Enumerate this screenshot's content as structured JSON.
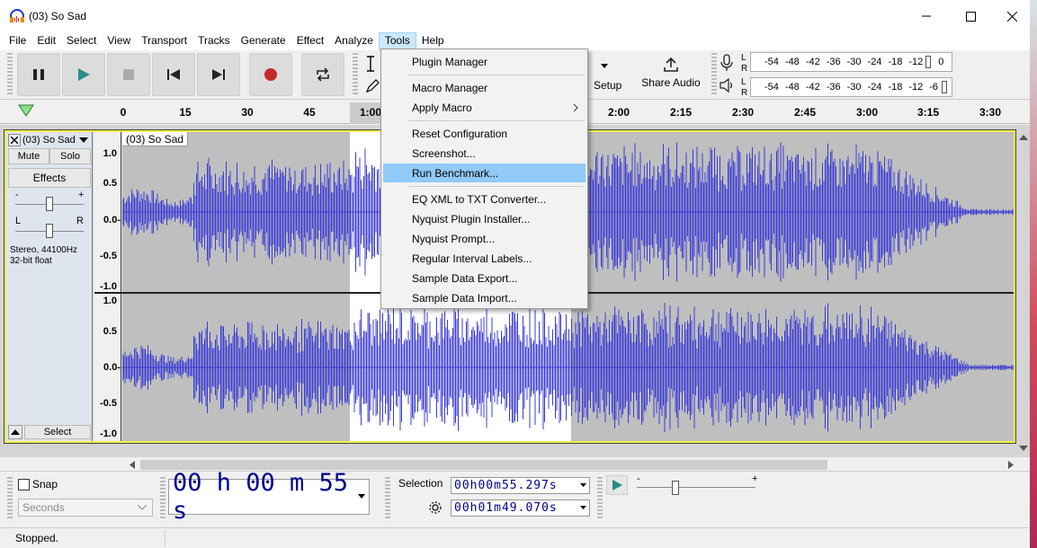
{
  "window": {
    "title": "(03) So Sad"
  },
  "menu": [
    "File",
    "Edit",
    "Select",
    "View",
    "Transport",
    "Tracks",
    "Generate",
    "Effect",
    "Analyze",
    "Tools",
    "Help"
  ],
  "toolbar": {
    "share_label": "Share Audio",
    "setup_label": "Setup"
  },
  "meters": {
    "record_scale": [
      "-54",
      "-48",
      "-42",
      "-36",
      "-30",
      "-24",
      "-18",
      "-12",
      "0"
    ],
    "play_scale": [
      "-54",
      "-48",
      "-42",
      "-36",
      "-30",
      "-24",
      "-18",
      "-12",
      "-6"
    ],
    "L": "L",
    "R": "R"
  },
  "ruler": {
    "ticks": [
      "0",
      "15",
      "30",
      "45",
      "1:00",
      "2:00",
      "2:15",
      "2:30",
      "2:45",
      "3:00",
      "3:15",
      "3:30"
    ]
  },
  "track": {
    "name": "(03) So Sad",
    "clip_name": "(03) So Sad",
    "mute": "Mute",
    "solo": "Solo",
    "effects": "Effects",
    "gain_minus": "-",
    "gain_plus": "+",
    "pan_l": "L",
    "pan_r": "R",
    "info_line1": "Stereo, 44100Hz",
    "info_line2": "32-bit float",
    "select": "Select",
    "scale_top": [
      "1.0",
      "0.5",
      "0.0-",
      "-0.5",
      "-1.0"
    ],
    "scale_bottom": [
      "1.0",
      "0.5",
      "0.0-",
      "-0.5",
      "-1.0"
    ]
  },
  "bottom": {
    "snap": "Snap",
    "snap_unit": "Seconds",
    "time": "00 h 00 m 55 s",
    "selection_label": "Selection",
    "sel_start": "00h00m55.297s",
    "sel_end": "00h01m49.070s",
    "speed_minus": "-",
    "speed_plus": "+"
  },
  "status": "Stopped.",
  "tools_menu": {
    "items": [
      "Plugin Manager",
      "Macro Manager",
      "Apply Macro",
      "Reset Configuration",
      "Screenshot...",
      "Run Benchmark...",
      "EQ XML to TXT Converter...",
      "Nyquist Plugin Installer...",
      "Nyquist Prompt...",
      "Regular Interval Labels...",
      "Sample Data Export...",
      "Sample Data Import..."
    ],
    "highlighted": "Run Benchmark..."
  },
  "colors": {
    "waveform": "#3c3cd6",
    "accent": "#f5f34b",
    "selection_highlight": "#91c9f7"
  }
}
